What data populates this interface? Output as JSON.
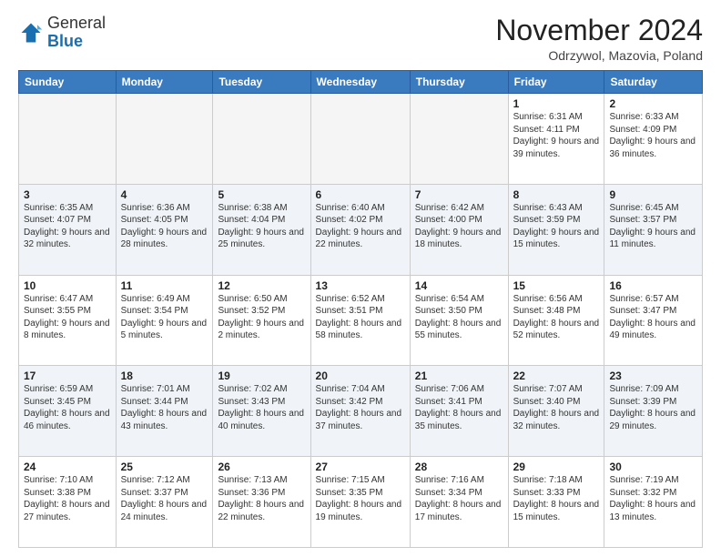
{
  "header": {
    "logo_general": "General",
    "logo_blue": "Blue",
    "month_title": "November 2024",
    "location": "Odrzywol, Mazovia, Poland"
  },
  "days_of_week": [
    "Sunday",
    "Monday",
    "Tuesday",
    "Wednesday",
    "Thursday",
    "Friday",
    "Saturday"
  ],
  "weeks": [
    [
      {
        "day": "",
        "empty": true
      },
      {
        "day": "",
        "empty": true
      },
      {
        "day": "",
        "empty": true
      },
      {
        "day": "",
        "empty": true
      },
      {
        "day": "",
        "empty": true
      },
      {
        "day": "1",
        "detail": "Sunrise: 6:31 AM\nSunset: 4:11 PM\nDaylight: 9 hours and 39 minutes."
      },
      {
        "day": "2",
        "detail": "Sunrise: 6:33 AM\nSunset: 4:09 PM\nDaylight: 9 hours and 36 minutes."
      }
    ],
    [
      {
        "day": "3",
        "detail": "Sunrise: 6:35 AM\nSunset: 4:07 PM\nDaylight: 9 hours and 32 minutes."
      },
      {
        "day": "4",
        "detail": "Sunrise: 6:36 AM\nSunset: 4:05 PM\nDaylight: 9 hours and 28 minutes."
      },
      {
        "day": "5",
        "detail": "Sunrise: 6:38 AM\nSunset: 4:04 PM\nDaylight: 9 hours and 25 minutes."
      },
      {
        "day": "6",
        "detail": "Sunrise: 6:40 AM\nSunset: 4:02 PM\nDaylight: 9 hours and 22 minutes."
      },
      {
        "day": "7",
        "detail": "Sunrise: 6:42 AM\nSunset: 4:00 PM\nDaylight: 9 hours and 18 minutes."
      },
      {
        "day": "8",
        "detail": "Sunrise: 6:43 AM\nSunset: 3:59 PM\nDaylight: 9 hours and 15 minutes."
      },
      {
        "day": "9",
        "detail": "Sunrise: 6:45 AM\nSunset: 3:57 PM\nDaylight: 9 hours and 11 minutes."
      }
    ],
    [
      {
        "day": "10",
        "detail": "Sunrise: 6:47 AM\nSunset: 3:55 PM\nDaylight: 9 hours and 8 minutes."
      },
      {
        "day": "11",
        "detail": "Sunrise: 6:49 AM\nSunset: 3:54 PM\nDaylight: 9 hours and 5 minutes."
      },
      {
        "day": "12",
        "detail": "Sunrise: 6:50 AM\nSunset: 3:52 PM\nDaylight: 9 hours and 2 minutes."
      },
      {
        "day": "13",
        "detail": "Sunrise: 6:52 AM\nSunset: 3:51 PM\nDaylight: 8 hours and 58 minutes."
      },
      {
        "day": "14",
        "detail": "Sunrise: 6:54 AM\nSunset: 3:50 PM\nDaylight: 8 hours and 55 minutes."
      },
      {
        "day": "15",
        "detail": "Sunrise: 6:56 AM\nSunset: 3:48 PM\nDaylight: 8 hours and 52 minutes."
      },
      {
        "day": "16",
        "detail": "Sunrise: 6:57 AM\nSunset: 3:47 PM\nDaylight: 8 hours and 49 minutes."
      }
    ],
    [
      {
        "day": "17",
        "detail": "Sunrise: 6:59 AM\nSunset: 3:45 PM\nDaylight: 8 hours and 46 minutes."
      },
      {
        "day": "18",
        "detail": "Sunrise: 7:01 AM\nSunset: 3:44 PM\nDaylight: 8 hours and 43 minutes."
      },
      {
        "day": "19",
        "detail": "Sunrise: 7:02 AM\nSunset: 3:43 PM\nDaylight: 8 hours and 40 minutes."
      },
      {
        "day": "20",
        "detail": "Sunrise: 7:04 AM\nSunset: 3:42 PM\nDaylight: 8 hours and 37 minutes."
      },
      {
        "day": "21",
        "detail": "Sunrise: 7:06 AM\nSunset: 3:41 PM\nDaylight: 8 hours and 35 minutes."
      },
      {
        "day": "22",
        "detail": "Sunrise: 7:07 AM\nSunset: 3:40 PM\nDaylight: 8 hours and 32 minutes."
      },
      {
        "day": "23",
        "detail": "Sunrise: 7:09 AM\nSunset: 3:39 PM\nDaylight: 8 hours and 29 minutes."
      }
    ],
    [
      {
        "day": "24",
        "detail": "Sunrise: 7:10 AM\nSunset: 3:38 PM\nDaylight: 8 hours and 27 minutes."
      },
      {
        "day": "25",
        "detail": "Sunrise: 7:12 AM\nSunset: 3:37 PM\nDaylight: 8 hours and 24 minutes."
      },
      {
        "day": "26",
        "detail": "Sunrise: 7:13 AM\nSunset: 3:36 PM\nDaylight: 8 hours and 22 minutes."
      },
      {
        "day": "27",
        "detail": "Sunrise: 7:15 AM\nSunset: 3:35 PM\nDaylight: 8 hours and 19 minutes."
      },
      {
        "day": "28",
        "detail": "Sunrise: 7:16 AM\nSunset: 3:34 PM\nDaylight: 8 hours and 17 minutes."
      },
      {
        "day": "29",
        "detail": "Sunrise: 7:18 AM\nSunset: 3:33 PM\nDaylight: 8 hours and 15 minutes."
      },
      {
        "day": "30",
        "detail": "Sunrise: 7:19 AM\nSunset: 3:32 PM\nDaylight: 8 hours and 13 minutes."
      }
    ]
  ]
}
